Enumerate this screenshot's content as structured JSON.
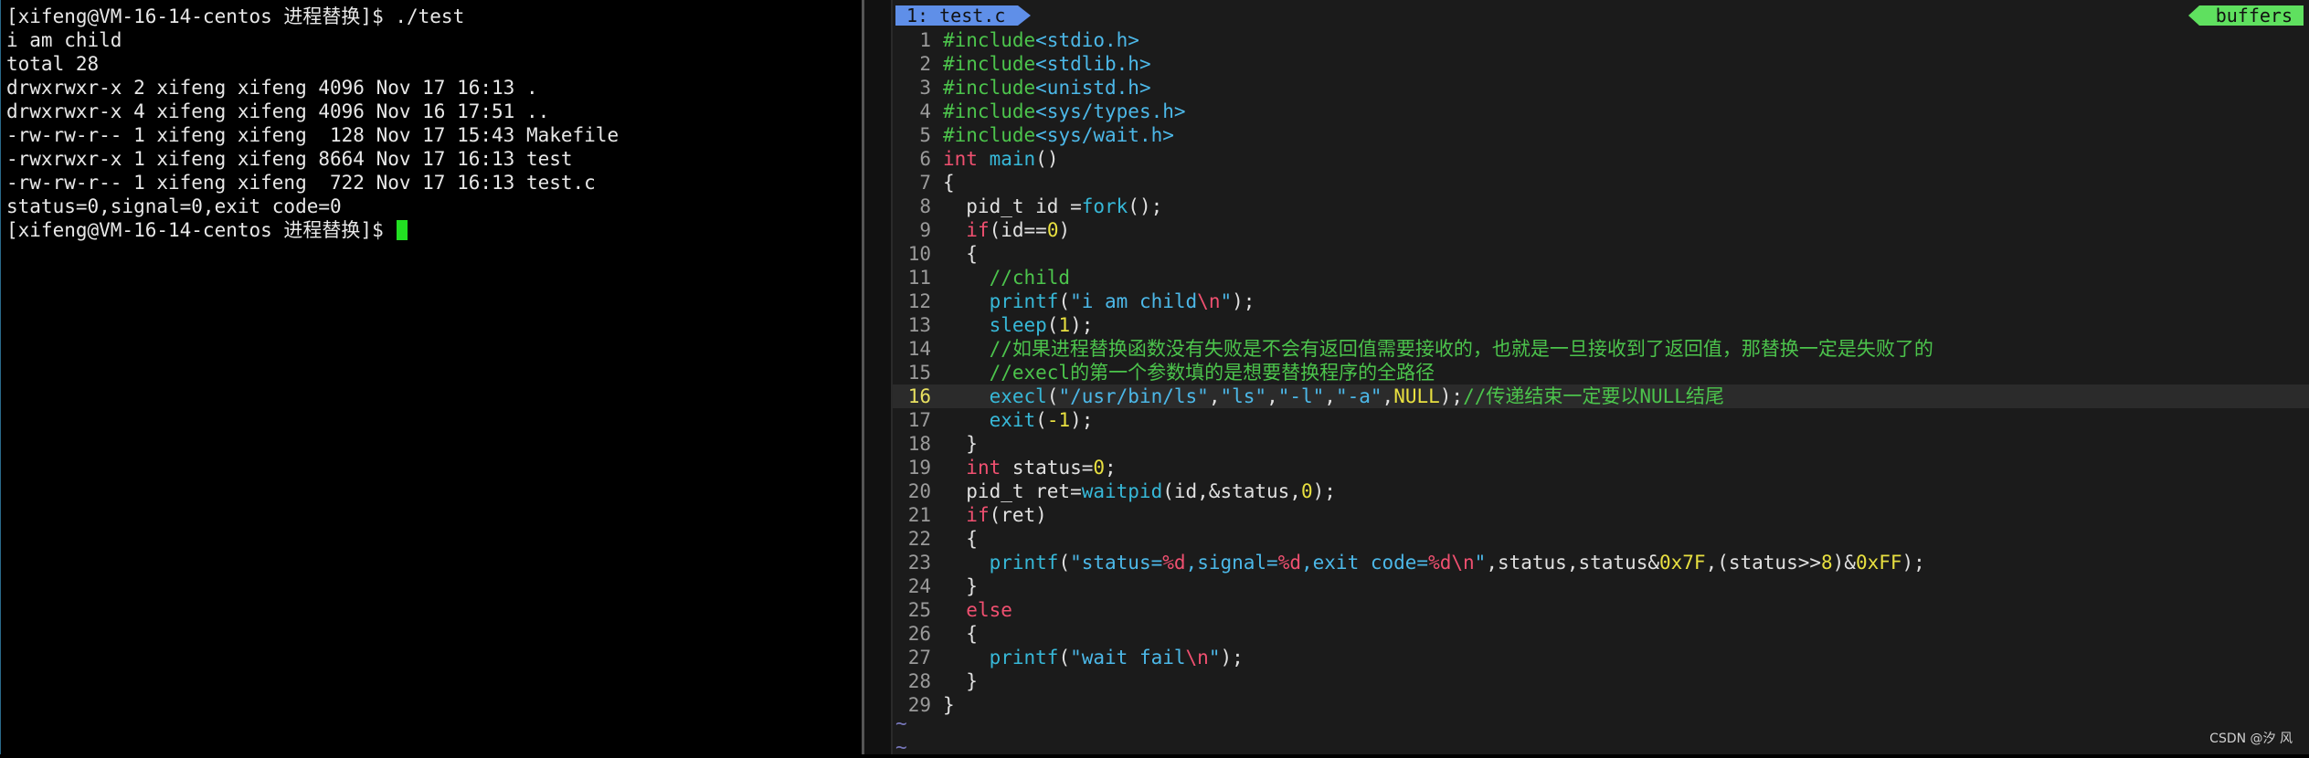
{
  "terminal": {
    "lines": [
      "[xifeng@VM-16-14-centos 进程替换]$ ./test",
      "i am child",
      "total 28",
      "drwxrwxr-x 2 xifeng xifeng 4096 Nov 17 16:13 .",
      "drwxrwxr-x 4 xifeng xifeng 4096 Nov 16 17:51 ..",
      "-rw-rw-r-- 1 xifeng xifeng  128 Nov 17 15:43 Makefile",
      "-rwxrwxr-x 1 xifeng xifeng 8664 Nov 17 16:13 test",
      "-rw-rw-r-- 1 xifeng xifeng  722 Nov 17 16:13 test.c",
      "status=0,signal=0,exit code=0"
    ],
    "prompt": "[xifeng@VM-16-14-centos 进程替换]$ "
  },
  "editor": {
    "tab_label": "1: test.c",
    "buffers_label": "buffers",
    "current_line": 16,
    "watermark": "CSDN @汐  风",
    "tilde": "~",
    "lines": [
      {
        "n": "1",
        "t": "#include<stdio.h>"
      },
      {
        "n": "2",
        "t": "#include<stdlib.h>"
      },
      {
        "n": "3",
        "t": "#include<unistd.h>"
      },
      {
        "n": "4",
        "t": "#include<sys/types.h>"
      },
      {
        "n": "5",
        "t": "#include<sys/wait.h>"
      },
      {
        "n": "6",
        "t": "int main()"
      },
      {
        "n": "7",
        "t": "{"
      },
      {
        "n": "8",
        "t": "  pid_t id =fork();"
      },
      {
        "n": "9",
        "t": "  if(id==0)"
      },
      {
        "n": "10",
        "t": "  {"
      },
      {
        "n": "11",
        "t": "    //child"
      },
      {
        "n": "12",
        "t": "    printf(\"i am child\\n\");"
      },
      {
        "n": "13",
        "t": "    sleep(1);"
      },
      {
        "n": "14",
        "t": "    //如果进程替换函数没有失败是不会有返回值需要接收的，也就是一旦接收到了返回值，那替换一定是失败了的"
      },
      {
        "n": "15",
        "t": "    //execl的第一个参数填的是想要替换程序的全路径"
      },
      {
        "n": "16",
        "t": "    execl(\"/usr/bin/ls\",\"ls\",\"-l\",\"-a\",NULL);//传递结束一定要以NULL结尾"
      },
      {
        "n": "17",
        "t": "    exit(-1);"
      },
      {
        "n": "18",
        "t": "  }"
      },
      {
        "n": "19",
        "t": "  int status=0;"
      },
      {
        "n": "20",
        "t": "  pid_t ret=waitpid(id,&status,0);"
      },
      {
        "n": "21",
        "t": "  if(ret)"
      },
      {
        "n": "22",
        "t": "  {"
      },
      {
        "n": "23",
        "t": "    printf(\"status=%d,signal=%d,exit code=%d\\n\",status,status&0x7F,(status>>8)&0xFF);"
      },
      {
        "n": "24",
        "t": "  }"
      },
      {
        "n": "25",
        "t": "  else"
      },
      {
        "n": "26",
        "t": "  {"
      },
      {
        "n": "27",
        "t": "    printf(\"wait fail\\n\");"
      },
      {
        "n": "28",
        "t": "  }"
      },
      {
        "n": "29",
        "t": "}"
      }
    ]
  },
  "colors": {
    "comment": "#4cc44c",
    "keyword": "#f05070",
    "function": "#37b8d8",
    "string": "#4cb8e8",
    "number": "#e8e040",
    "tab_active": "#5f8fe8",
    "buffers_tag": "#5fe05f",
    "cursor": "#22e022"
  }
}
